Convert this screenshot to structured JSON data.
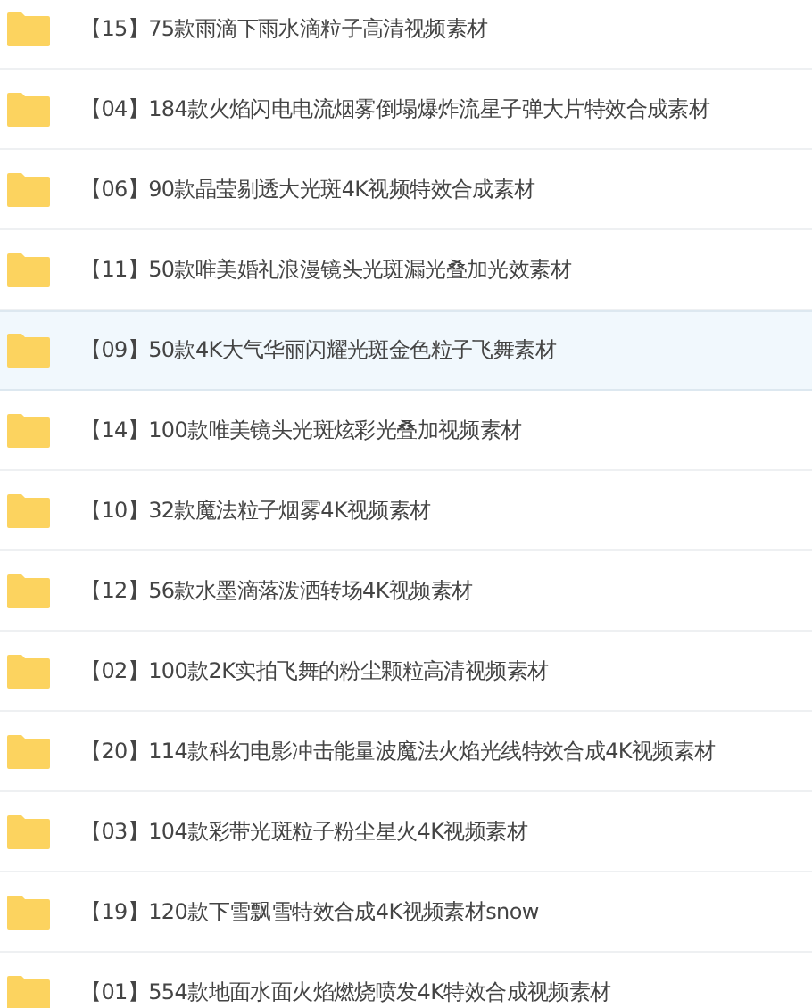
{
  "folders": [
    {
      "name": "【15】75款雨滴下雨水滴粒子高清视频素材",
      "selected": false
    },
    {
      "name": "【04】184款火焰闪电电流烟雾倒塌爆炸流星子弹大片特效合成素材",
      "selected": false
    },
    {
      "name": "【06】90款晶莹剔透大光斑4K视频特效合成素材",
      "selected": false
    },
    {
      "name": "【11】50款唯美婚礼浪漫镜头光斑漏光叠加光效素材",
      "selected": false
    },
    {
      "name": "【09】50款4K大气华丽闪耀光斑金色粒子飞舞素材",
      "selected": true
    },
    {
      "name": "【14】100款唯美镜头光斑炫彩光叠加视频素材",
      "selected": false
    },
    {
      "name": "【10】32款魔法粒子烟雾4K视频素材",
      "selected": false
    },
    {
      "name": "【12】56款水墨滴落泼洒转场4K视频素材",
      "selected": false
    },
    {
      "name": "【02】100款2K实拍飞舞的粉尘颗粒高清视频素材",
      "selected": false
    },
    {
      "name": "【20】114款科幻电影冲击能量波魔法火焰光线特效合成4K视频素材",
      "selected": false
    },
    {
      "name": "【03】104款彩带光斑粒子粉尘星火4K视频素材",
      "selected": false
    },
    {
      "name": "【19】120款下雪飘雪特效合成4K视频素材snow",
      "selected": false
    },
    {
      "name": "【01】554款地面水面火焰燃烧喷发4K特效合成视频素材",
      "selected": false
    }
  ]
}
